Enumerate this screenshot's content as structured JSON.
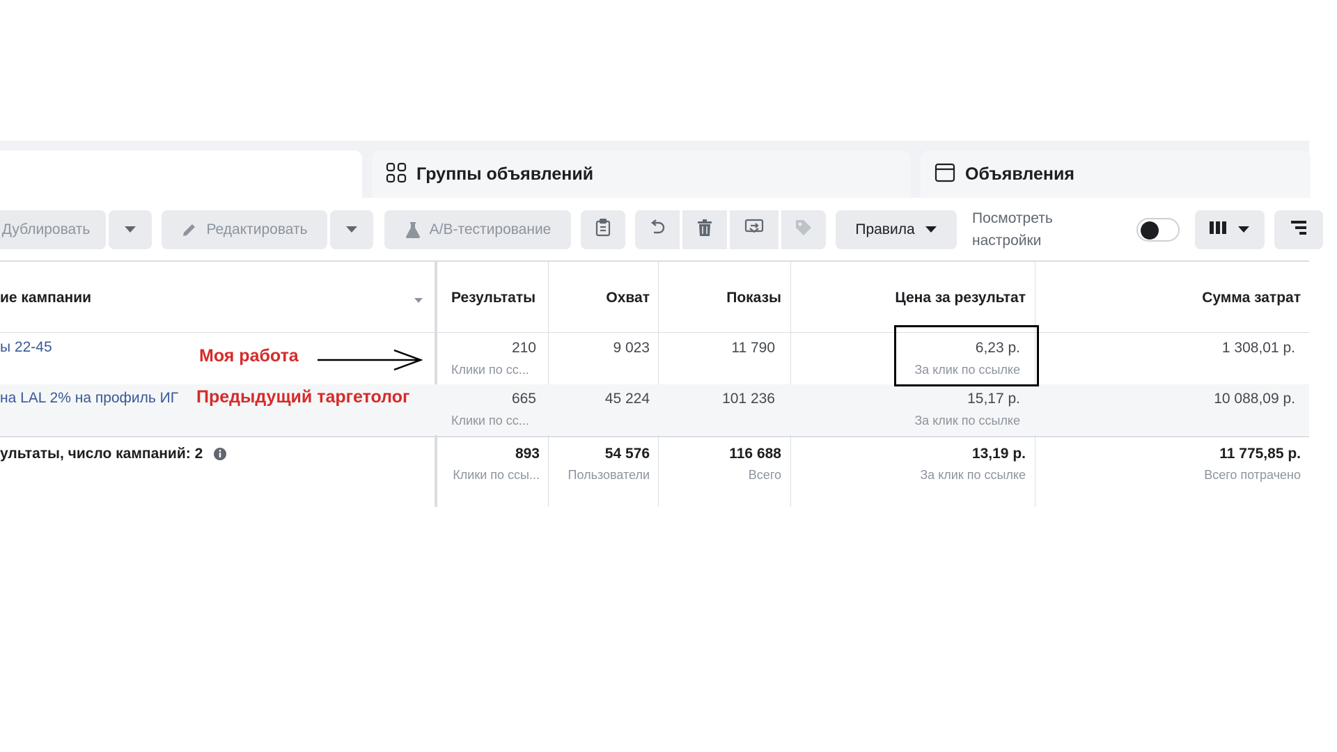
{
  "tabs": {
    "ad_groups": "Группы объявлений",
    "ads": "Объявления"
  },
  "toolbar": {
    "duplicate": "Дублировать",
    "edit": "Редактировать",
    "ab_test": "A/B-тестирование",
    "rules": "Правила",
    "view_settings": "Посмотреть настройки"
  },
  "columns": {
    "campaign_name": "ие кампании",
    "results": "Результаты",
    "reach": "Охват",
    "impressions": "Показы",
    "cost_per_result": "Цена за результат",
    "amount_spent": "Сумма затрат"
  },
  "rows": [
    {
      "name": "ы 22-45",
      "note": "Моя работа",
      "results": "210",
      "results_sub": "Клики по сс...",
      "reach": "9 023",
      "impressions": "11 790",
      "cost": "6,23 р.",
      "cost_sub": "За клик по ссылке",
      "spent": "1 308,01 р."
    },
    {
      "name": "на LAL 2% на профиль ИГ",
      "note": "Предыдущий таргетолог",
      "results": "665",
      "results_sub": "Клики по сс...",
      "reach": "45 224",
      "impressions": "101 236",
      "cost": "15,17 р.",
      "cost_sub": "За клик по ссылке",
      "spent": "10 088,09 р."
    }
  ],
  "totals": {
    "label": "ультаты, число кампаний: 2",
    "results": "893",
    "results_sub": "Клики по ссы...",
    "reach": "54 576",
    "reach_sub": "Пользователи",
    "impressions": "116 688",
    "impressions_sub": "Всего",
    "cost": "13,19 р.",
    "cost_sub": "За клик по ссылке",
    "spent": "11 775,85 р.",
    "spent_sub": "Всего потрачено"
  },
  "icons": {
    "ad_groups_tab": "grid-icon",
    "ads_tab": "window-icon",
    "edit": "pencil-icon",
    "ab_test": "flask-icon",
    "copy": "clipboard-icon",
    "undo": "undo-icon",
    "delete": "trash-icon",
    "preview": "preview-icon",
    "tag": "tag-icon",
    "columns": "columns-icon",
    "breakdown": "breakdown-icon",
    "info": "info-icon"
  },
  "colors": {
    "annotation": "#d52b2b",
    "link": "#385898",
    "highlight_border": "#000000"
  }
}
